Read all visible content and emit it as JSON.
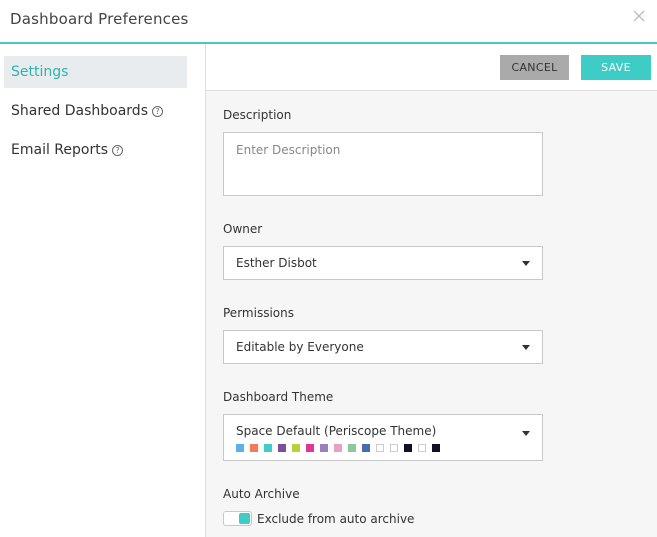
{
  "dialog": {
    "title": "Dashboard Preferences",
    "close_icon": "close-icon"
  },
  "sidebar": {
    "items": [
      {
        "label": "Settings",
        "active": true,
        "help": false
      },
      {
        "label": "Shared Dashboards",
        "active": false,
        "help": true
      },
      {
        "label": "Email Reports",
        "active": false,
        "help": true
      }
    ],
    "help_glyph": "?"
  },
  "toolbar": {
    "cancel_label": "CANCEL",
    "save_label": "SAVE"
  },
  "form": {
    "description": {
      "label": "Description",
      "placeholder": "Enter Description",
      "value": ""
    },
    "owner": {
      "label": "Owner",
      "value": "Esther Disbot"
    },
    "permissions": {
      "label": "Permissions",
      "value": "Editable by Everyone"
    },
    "theme": {
      "label": "Dashboard Theme",
      "value": "Space Default (Periscope Theme)",
      "swatch_colors": [
        "#5bb0e8",
        "#f07a5a",
        "#3ecdc6",
        "#7b4fa0",
        "#b8d432",
        "#e0389a",
        "#9a7fc0",
        "#e8a0c8",
        "#8ec79a",
        "#4a6ab0",
        "#ffffff",
        "#ffffff",
        "#111122",
        "#ffffff",
        "#111122"
      ]
    },
    "auto_archive": {
      "label": "Auto Archive",
      "toggle_label": "Exclude from auto archive",
      "enabled": true
    }
  },
  "colors": {
    "accent": "#3ecdc6",
    "cancel_bg": "#aaaaaa"
  }
}
